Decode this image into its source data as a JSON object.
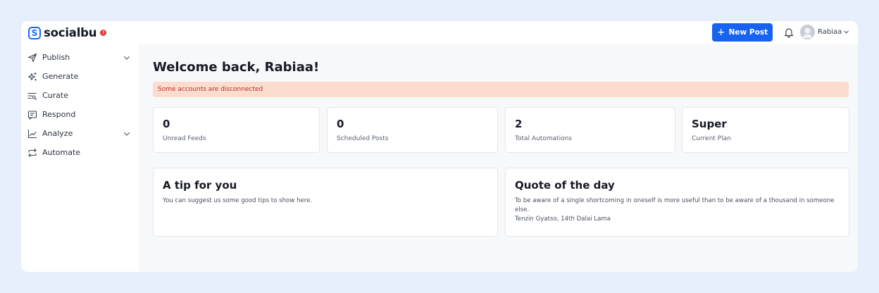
{
  "app": {
    "logo_text": "socialbu",
    "logo_badge": "!"
  },
  "topbar": {
    "new_post_plus": "+",
    "new_post_label": "New Post",
    "user_name": "Rabiaa"
  },
  "sidebar": {
    "items": [
      {
        "label": "Publish",
        "icon": "send-icon",
        "has_chevron": true
      },
      {
        "label": "Generate",
        "icon": "sparkles-icon",
        "has_chevron": false
      },
      {
        "label": "Curate",
        "icon": "list-search-icon",
        "has_chevron": false
      },
      {
        "label": "Respond",
        "icon": "message-icon",
        "has_chevron": false
      },
      {
        "label": "Analyze",
        "icon": "line-chart-icon",
        "has_chevron": true
      },
      {
        "label": "Automate",
        "icon": "repeat-icon",
        "has_chevron": false
      }
    ]
  },
  "main": {
    "welcome": "Welcome back, Rabiaa!",
    "alert": "Some accounts are disconnected",
    "stats": [
      {
        "value": "0",
        "label": "Unread Feeds"
      },
      {
        "value": "0",
        "label": "Scheduled Posts"
      },
      {
        "value": "2",
        "label": "Total Automations"
      },
      {
        "value": "Super",
        "label": "Current Plan"
      }
    ],
    "tip": {
      "title": "A tip for you",
      "body": "You can suggest us some good tips to show here."
    },
    "quote": {
      "title": "Quote of the day",
      "text": "To be aware of a single shortcoming in oneself is more useful than to be aware of a thousand in someone else.",
      "author": "Tenzin Gyatso, 14th Dalai Lama"
    }
  },
  "colors": {
    "page_bg": "#e8effc",
    "primary": "#1763f0",
    "alert_bg": "#fcdccd",
    "alert_text": "#b4322c",
    "badge_red": "#e23c3c"
  }
}
